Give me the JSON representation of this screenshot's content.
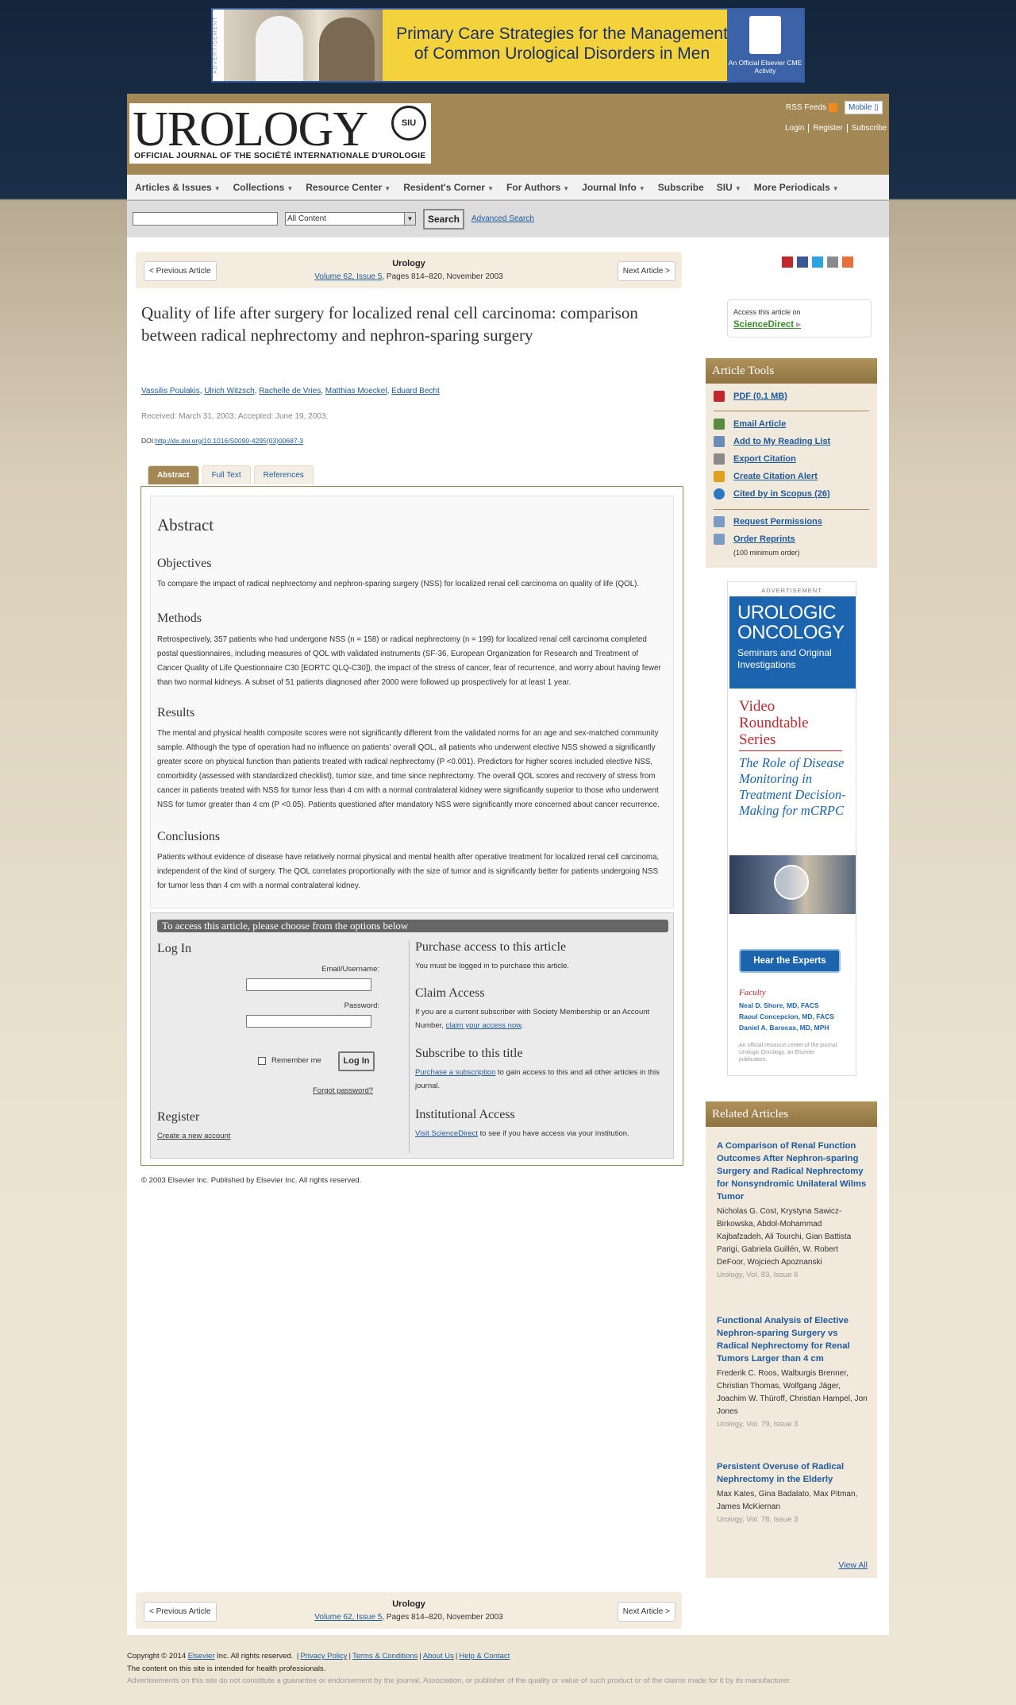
{
  "top_ad": {
    "side_label": "ADVERTISEMENT",
    "headline": "Primary Care Strategies for the Management of Common Urological Disorders in Men",
    "badge": "An Official Elsevier CME Activity"
  },
  "header": {
    "logo_word": "UROLOGY",
    "seal_text": "SIU",
    "logo_sub": "OFFICIAL JOURNAL OF THE SOCIÉTÉ INTERNATIONALE D'UROLOGIE",
    "rss": "RSS Feeds",
    "mobile": "Mobile",
    "login": "Login",
    "register": "Register",
    "subscribe": "Subscribe"
  },
  "nav": [
    "Articles & Issues",
    "Collections",
    "Resource Center",
    "Resident's Corner",
    "For Authors",
    "Journal Info",
    "Subscribe",
    "SIU",
    "More Periodicals"
  ],
  "nav_dropdowns": [
    true,
    true,
    true,
    true,
    true,
    true,
    false,
    true,
    true
  ],
  "search": {
    "value": "",
    "select": "All Content",
    "button": "Search",
    "advanced": "Advanced Search"
  },
  "article_nav": {
    "prev": "< Previous Article",
    "next": "Next Article >",
    "journal": "Urology",
    "issue_link": "Volume 62, Issue 5",
    "pages": ", Pages 814–820, November 2003"
  },
  "article": {
    "title": "Quality of life after surgery for localized renal cell carcinoma: comparison between radical nephrectomy and nephron-sparing surgery",
    "authors": [
      "Vassilis Poulakis",
      "Ulrich Witzsch",
      "Rachelle de Vries",
      "Matthias Moeckel",
      "Eduard Becht"
    ],
    "dates": "Received: March 31, 2003; Accepted: June 19, 2003;",
    "doi_label": "DOI:",
    "doi": "http://dx.doi.org/10.1016/S0090-4295(03)00687-3",
    "tabs": [
      "Abstract",
      "Full Text",
      "References"
    ],
    "abstract_heading": "Abstract",
    "sections": [
      {
        "h": "Objectives",
        "p": "To compare the impact of radical nephrectomy and nephron-sparing surgery (NSS) for localized renal cell carcinoma on quality of life (QOL)."
      },
      {
        "h": "Methods",
        "p": "Retrospectively, 357 patients who had undergone NSS (n = 158) or radical nephrectomy (n = 199) for localized renal cell carcinoma completed postal questionnaires, including measures of QOL with validated instruments (SF-36, European Organization for Research and Treatment of Cancer Quality of Life Questionnaire C30 [EORTC QLQ-C30]), the impact of the stress of cancer, fear of recurrence, and worry about having fewer than two normal kidneys. A subset of 51 patients diagnosed after 2000 were followed up prospectively for at least 1 year."
      },
      {
        "h": "Results",
        "p": "The mental and physical health composite scores were not significantly different from the validated norms for an age and sex-matched community sample. Although the type of operation had no influence on patients' overall QOL, all patients who underwent elective NSS showed a significantly greater score on physical function than patients treated with radical nephrectomy (P <0.001). Predictors for higher scores included elective NSS, comorbidity (assessed with standardized checklist), tumor size, and time since nephrectomy. The overall QOL scores and recovery of stress from cancer in patients treated with NSS for tumor less than 4 cm with a normal contralateral kidney were significantly superior to those who underwent NSS for tumor greater than 4 cm (P <0.05). Patients questioned after mandatory NSS were significantly more concerned about cancer recurrence."
      },
      {
        "h": "Conclusions",
        "p": "Patients without evidence of disease have relatively normal physical and mental health after operative treatment for localized renal cell carcinoma, independent of the kind of surgery. The QOL correlates proportionally with the size of tumor and is significantly better for patients undergoing NSS for tumor less than 4 cm with a normal contralateral kidney."
      }
    ],
    "copyright": "© 2003 Elsevier Inc. Published by Elsevier Inc. All rights reserved."
  },
  "access": {
    "bar": "To access this article, please choose from the options below",
    "login_h": "Log In",
    "email_label": "Email/Username:",
    "password_label": "Password:",
    "remember": "Remember me",
    "login_btn": "Log In",
    "forgot": "Forgot password?",
    "register_h": "Register",
    "create": "Create a new account",
    "purchase_h": "Purchase access to this article",
    "purchase_p": "You must be logged in to purchase this article.",
    "claim_h": "Claim Access",
    "claim_p": "If you are a current subscriber with Society Membership or an Account Number,",
    "claim_link": "claim your access now",
    "subscribe_h": "Subscribe to this title",
    "subscribe_link": "Purchase a subscription",
    "subscribe_p": " to gain access to this and all other articles in this journal.",
    "inst_h": "Institutional Access",
    "inst_link": "Visit ScienceDirect",
    "inst_p": " to see if you have access via your institution."
  },
  "sciencedirect": {
    "label": "Access this article on",
    "name": "ScienceDirect"
  },
  "tools": {
    "heading": "Article Tools",
    "items": [
      "PDF (0.1 MB)",
      "Email Article",
      "Add to My Reading List",
      "Export Citation",
      "Create Citation Alert",
      "Cited by in Scopus (26)",
      "Request Permissions",
      "Order Reprints"
    ],
    "reprint_note": "(100 minimum order)"
  },
  "side_ad": {
    "label": "ADVERTISEMENT",
    "title": "UROLOGIC ONCOLOGY",
    "subtitle": "Seminars and Original Investigations",
    "series": "Video Roundtable Series",
    "topic": "The Role of Disease Monitoring in Treatment Decision-Making for mCRPC",
    "button": "Hear the Experts",
    "faculty": "Faculty",
    "names": [
      "Neal D. Shore, MD, FACS",
      "Raoul Concepcion, MD, FACS",
      "Daniel A. Barocas, MD, MPH"
    ],
    "fine": "An official resource center of the journal Urologic Oncology, an Elsevier publication."
  },
  "related": {
    "heading": "Related Articles",
    "items": [
      {
        "title": "A Comparison of Renal Function Outcomes After Nephron-sparing Surgery and Radical Nephrectomy for Nonsyndromic Unilateral Wilms Tumor",
        "authors": "Nicholas G. Cost, Krystyna Sawicz-Birkowska, Abdol-Mohammad Kajbafzadeh, Ali Tourchi, Gian Battista Parigi, Gabriela Guillén, W. Robert DeFoor, Wojciech Apoznanski",
        "source": "Urology, Vol. 83, Issue 6"
      },
      {
        "title": "Functional Analysis of Elective Nephron-sparing Surgery vs Radical Nephrectomy for Renal Tumors Larger than 4 cm",
        "authors": "Frederik C. Roos, Walburgis Brenner, Christian Thomas, Wolfgang Jäger, Joachim W. Thüroff, Christian Hampel, Jon Jones",
        "source": "Urology, Vol. 79, Issue 3"
      },
      {
        "title": "Persistent Overuse of Radical Nephrectomy in the Elderly",
        "authors": "Max Kates, Gina Badalato, Max Pitman, James McKiernan",
        "source": "Urology, Vol. 78, Issue 3"
      }
    ],
    "view_all": "View All"
  },
  "footer": {
    "line1_pre": "Copyright © 2014",
    "elsevier": "Elsevier",
    "line1_post": "Inc. All rights reserved.",
    "links": [
      "Privacy Policy",
      "Terms & Conditions",
      "About Us",
      "Help & Contact"
    ],
    "line2": "The content on this site is intended for health professionals.",
    "line3": "Advertisements on this site do not constitute a guarantee or endorsement by the journal, Association, or publisher of the quality or value of such product or of the claims made for it by its manufacturer."
  },
  "colors": {
    "brand_gold": "#a38754",
    "link": "#1f5a9c",
    "navy_bg": "#14263c",
    "sciencedirect": "#3b8a2c"
  }
}
